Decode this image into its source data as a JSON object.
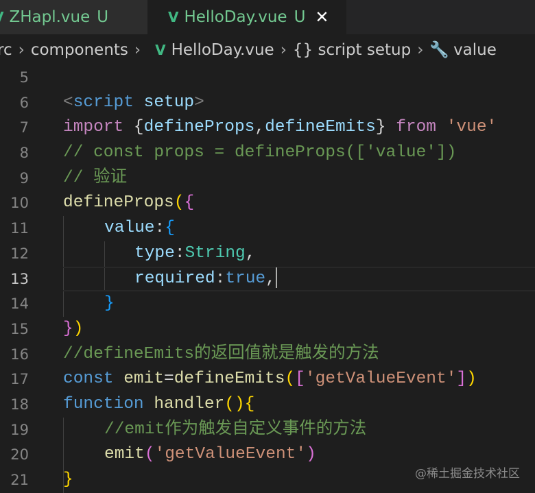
{
  "tabs": [
    {
      "label": "ZHapl.vue",
      "status": "U",
      "icon": "vue-icon"
    },
    {
      "label": "HelloDay.vue",
      "status": "U",
      "icon": "vue-icon",
      "active": true,
      "close": "✕"
    }
  ],
  "breadcrumb": [
    "rc",
    "components",
    "HelloDay.vue",
    "{} script setup",
    "value"
  ],
  "code": [
    {
      "n": "5",
      "tokens": []
    },
    {
      "n": "6",
      "tokens": [
        {
          "t": "<",
          "k": "tag"
        },
        {
          "t": "script",
          "k": "tagname"
        },
        {
          "t": " ",
          "k": "plain"
        },
        {
          "t": "setup",
          "k": "attr"
        },
        {
          "t": ">",
          "k": "tag"
        }
      ]
    },
    {
      "n": "7",
      "tokens": [
        {
          "t": "import ",
          "k": "kw"
        },
        {
          "t": "{",
          "k": "plain"
        },
        {
          "t": "defineProps",
          "k": "prop"
        },
        {
          "t": ",",
          "k": "plain"
        },
        {
          "t": "defineEmits",
          "k": "prop"
        },
        {
          "t": "}",
          "k": "plain"
        },
        {
          "t": " from ",
          "k": "kw"
        },
        {
          "t": "'vue'",
          "k": "str"
        }
      ]
    },
    {
      "n": "8",
      "tokens": [
        {
          "t": "// const props = defineProps(['value'])",
          "k": "cmt"
        }
      ]
    },
    {
      "n": "9",
      "tokens": [
        {
          "t": "// 验证",
          "k": "cmt"
        }
      ]
    },
    {
      "n": "10",
      "tokens": [
        {
          "t": "defineProps",
          "k": "fn"
        },
        {
          "t": "(",
          "k": "b1"
        },
        {
          "t": "{",
          "k": "b2"
        }
      ]
    },
    {
      "n": "11",
      "indent": 4,
      "tokens": [
        {
          "t": "value",
          "k": "prop"
        },
        {
          "t": ":",
          "k": "plain"
        },
        {
          "t": "{",
          "k": "b3"
        }
      ]
    },
    {
      "n": "12",
      "indent": 7,
      "tokens": [
        {
          "t": "type",
          "k": "prop"
        },
        {
          "t": ":",
          "k": "plain"
        },
        {
          "t": "String",
          "k": "type"
        },
        {
          "t": ",",
          "k": "plain"
        }
      ]
    },
    {
      "n": "13",
      "indent": 7,
      "current": true,
      "tokens": [
        {
          "t": "required",
          "k": "prop"
        },
        {
          "t": ":",
          "k": "plain"
        },
        {
          "t": "true",
          "k": "blue"
        },
        {
          "t": ",",
          "k": "plain"
        }
      ]
    },
    {
      "n": "14",
      "indent": 4,
      "tokens": [
        {
          "t": "}",
          "k": "b3"
        }
      ]
    },
    {
      "n": "15",
      "tokens": [
        {
          "t": "}",
          "k": "b2"
        },
        {
          "t": ")",
          "k": "b1"
        }
      ]
    },
    {
      "n": "16",
      "tokens": [
        {
          "t": "//defineEmits的返回值就是触发的方法",
          "k": "cmt"
        }
      ]
    },
    {
      "n": "17",
      "tokens": [
        {
          "t": "const ",
          "k": "blue"
        },
        {
          "t": "emit",
          "k": "fn"
        },
        {
          "t": "=",
          "k": "plain"
        },
        {
          "t": "defineEmits",
          "k": "fn"
        },
        {
          "t": "(",
          "k": "b1"
        },
        {
          "t": "[",
          "k": "b2"
        },
        {
          "t": "'getValueEvent'",
          "k": "str"
        },
        {
          "t": "]",
          "k": "b2"
        },
        {
          "t": ")",
          "k": "b1"
        }
      ]
    },
    {
      "n": "18",
      "tokens": [
        {
          "t": "function ",
          "k": "blue"
        },
        {
          "t": "handler",
          "k": "fn"
        },
        {
          "t": "()",
          "k": "b1"
        },
        {
          "t": "{",
          "k": "b1"
        }
      ]
    },
    {
      "n": "19",
      "indent": 4,
      "tokens": [
        {
          "t": "//emit作为触发自定义事件的方法",
          "k": "cmt"
        }
      ]
    },
    {
      "n": "20",
      "indent": 4,
      "tokens": [
        {
          "t": "emit",
          "k": "fn"
        },
        {
          "t": "(",
          "k": "b2"
        },
        {
          "t": "'getValueEvent'",
          "k": "str"
        },
        {
          "t": ")",
          "k": "b2"
        }
      ]
    },
    {
      "n": "21",
      "tokens": [
        {
          "t": "}",
          "k": "b1"
        }
      ]
    }
  ],
  "watermark": "@稀土掘金技术社区"
}
